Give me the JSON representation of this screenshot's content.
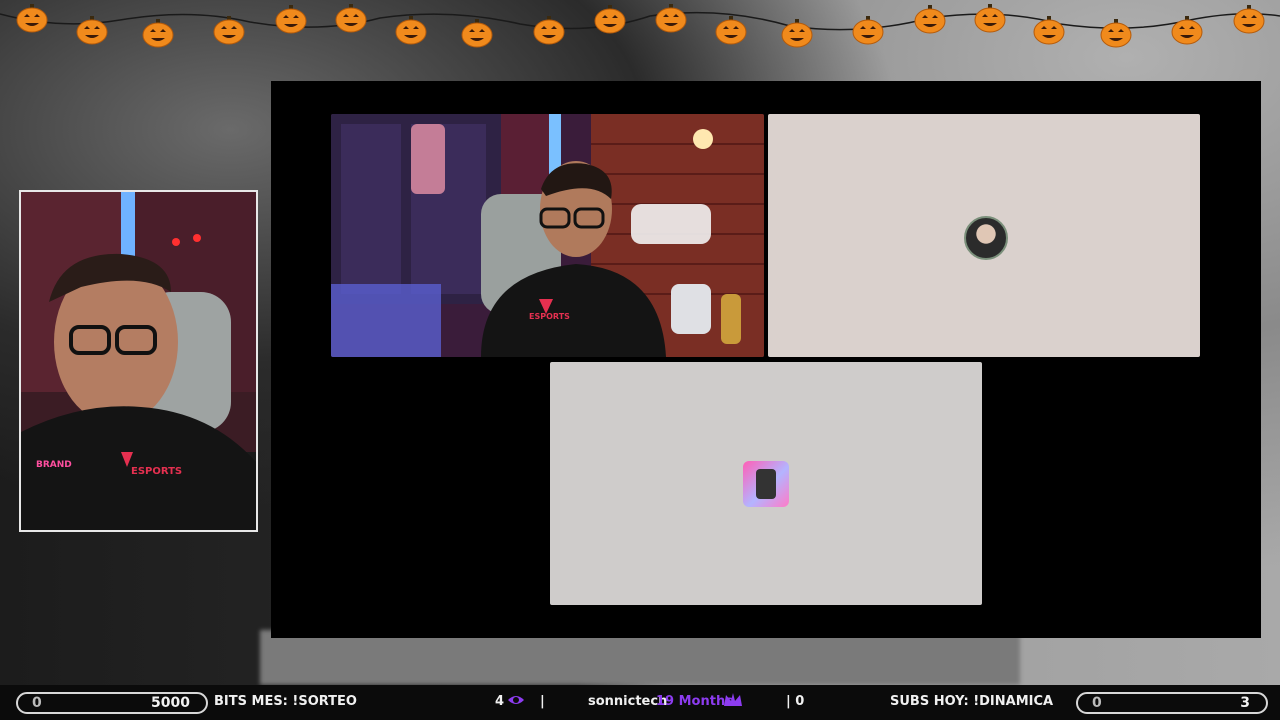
{
  "bottom_bar": {
    "bits": {
      "current": "0",
      "goal": "5000",
      "label": "BITS MES: !SORTEO"
    },
    "viewers": {
      "count": "4",
      "sep": "|"
    },
    "sub": {
      "user": "sonnictech",
      "months": "19 Months"
    },
    "counter": "| 0",
    "subs": {
      "label": "SUBS HOY: !DINAMICA",
      "current": "0",
      "goal": "3"
    }
  },
  "colors": {
    "accent_purple": "#8d3cf0",
    "panel_bg": "#000000",
    "tile_grey_1": "#dad1cd",
    "tile_grey_2": "#cfcccb",
    "pumpkin_orange": "#f08a1c"
  },
  "icons": [
    "pumpkin-icon",
    "eye-icon",
    "crown-icon"
  ]
}
